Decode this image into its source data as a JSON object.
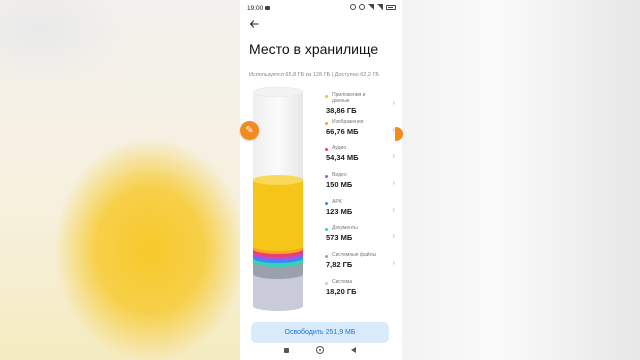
{
  "status": {
    "time": "19:00"
  },
  "header": {
    "title": "Место в хранилище"
  },
  "usage_text": "Используется 65,8 ГБ из 128 ГБ | Доступно 62,2 ГБ",
  "categories": [
    {
      "label": "Приложения и данные",
      "value": "38,86 ГБ",
      "color": "#f5c518"
    },
    {
      "label": "Изображения",
      "value": "66,76 МБ",
      "color": "#f5a623"
    },
    {
      "label": "Аудио",
      "value": "54,34 МБ",
      "color": "#ec3f6b"
    },
    {
      "label": "Видео",
      "value": "150 МБ",
      "color": "#b14fd8"
    },
    {
      "label": "APK",
      "value": "123 МБ",
      "color": "#3a86ff"
    },
    {
      "label": "Документы",
      "value": "573 МБ",
      "color": "#37d1b4"
    },
    {
      "label": "Системные файлы",
      "value": "7,82 ГБ",
      "color": "#9aa0ad"
    },
    {
      "label": "Система",
      "value": "18,20 ГБ",
      "color": "#c9ccd8"
    }
  ],
  "free_button": "Освободить 251,9 МБ",
  "icons": {
    "back": "arrow-left-icon",
    "chevron": "chevron-right-icon",
    "edit": "brush-icon"
  }
}
